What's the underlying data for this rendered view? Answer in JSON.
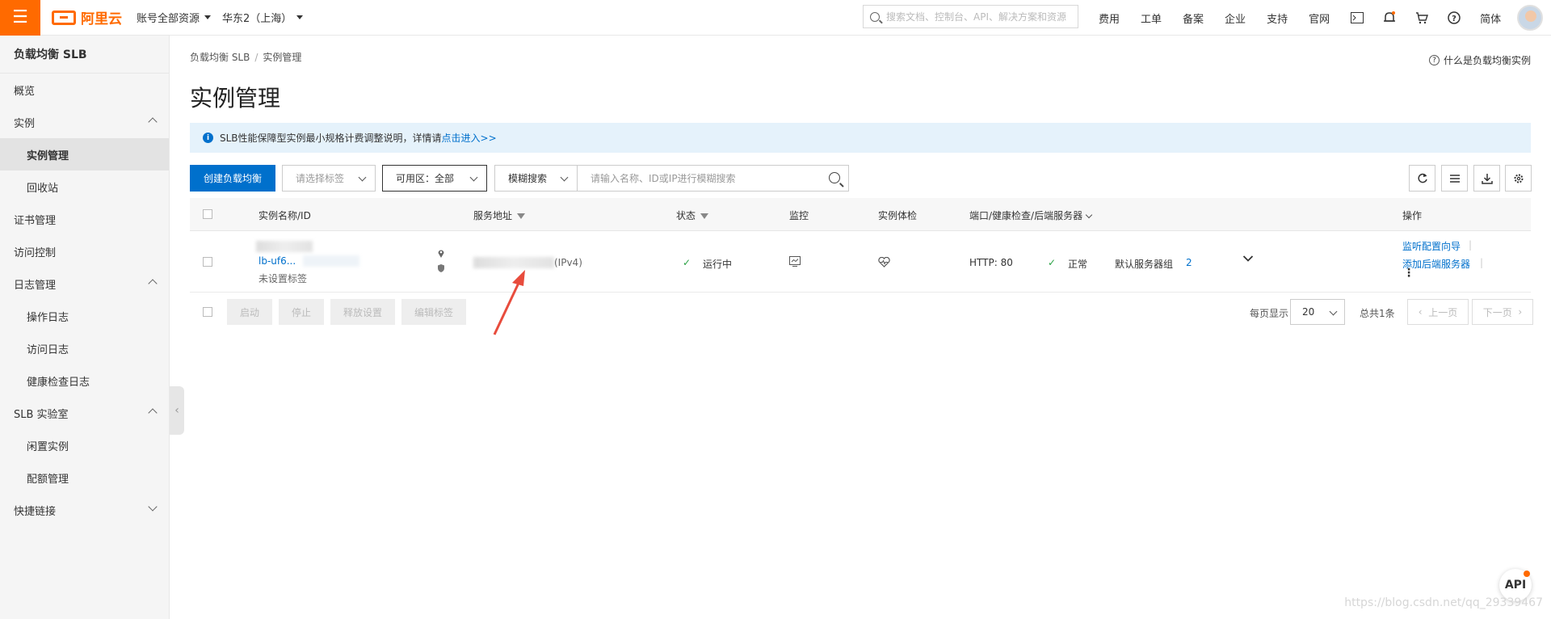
{
  "topbar": {
    "menu_icon": "menu-icon",
    "logo_text": "阿里云",
    "account_selector": "账号全部资源",
    "region_selector": "华东2（上海）",
    "search_placeholder": "搜索文档、控制台、API、解决方案和资源",
    "links": [
      "费用",
      "工单",
      "备案",
      "企业",
      "支持",
      "官网"
    ],
    "lang": "简体"
  },
  "sidebar": {
    "title": "负载均衡 SLB",
    "items": [
      {
        "label": "概览"
      },
      {
        "label": "实例"
      },
      {
        "label": "实例管理"
      },
      {
        "label": "回收站"
      },
      {
        "label": "证书管理"
      },
      {
        "label": "访问控制"
      },
      {
        "label": "日志管理"
      },
      {
        "label": "操作日志"
      },
      {
        "label": "访问日志"
      },
      {
        "label": "健康检查日志"
      },
      {
        "label": "SLB 实验室"
      },
      {
        "label": "闲置实例"
      },
      {
        "label": "配额管理"
      },
      {
        "label": "快捷链接"
      }
    ]
  },
  "main": {
    "breadcrumb": [
      "负载均衡 SLB",
      "实例管理"
    ],
    "help_link": "什么是负载均衡实例",
    "title": "实例管理",
    "notice": {
      "text": "SLB性能保障型实例最小规格计费调整说明，详情请",
      "link": "点击进入>>"
    },
    "toolbar": {
      "create_button": "创建负载均衡",
      "tag_select_placeholder": "请选择标签",
      "zone_select": "可用区：全部",
      "search_mode": "模糊搜索",
      "search_placeholder": "请输入名称、ID或IP进行模糊搜索"
    },
    "table": {
      "headers": [
        "实例名称/ID",
        "服务地址",
        "状态",
        "监控",
        "实例体检",
        "端口/健康检查/后端服务器",
        "操作"
      ],
      "rows": [
        {
          "id_visible": "lb-uf6...",
          "tag": "未设置标签",
          "address_suffix": "(IPv4)",
          "status": "运行中",
          "port": "HTTP:   80",
          "health": "正常",
          "backend_group": "默认服务器组",
          "backend_count": "2",
          "actions": [
            "监听配置向导",
            "添加后端服务器"
          ]
        }
      ],
      "footer_buttons": [
        "启动",
        "停止",
        "释放设置",
        "编辑标签"
      ],
      "page_size_label": "每页显示",
      "page_size": "20",
      "total": "总共1条",
      "prev": "上一页",
      "next": "下一页"
    }
  },
  "api_badge": "API",
  "watermark": "https://blog.csdn.net/qq_29339467"
}
